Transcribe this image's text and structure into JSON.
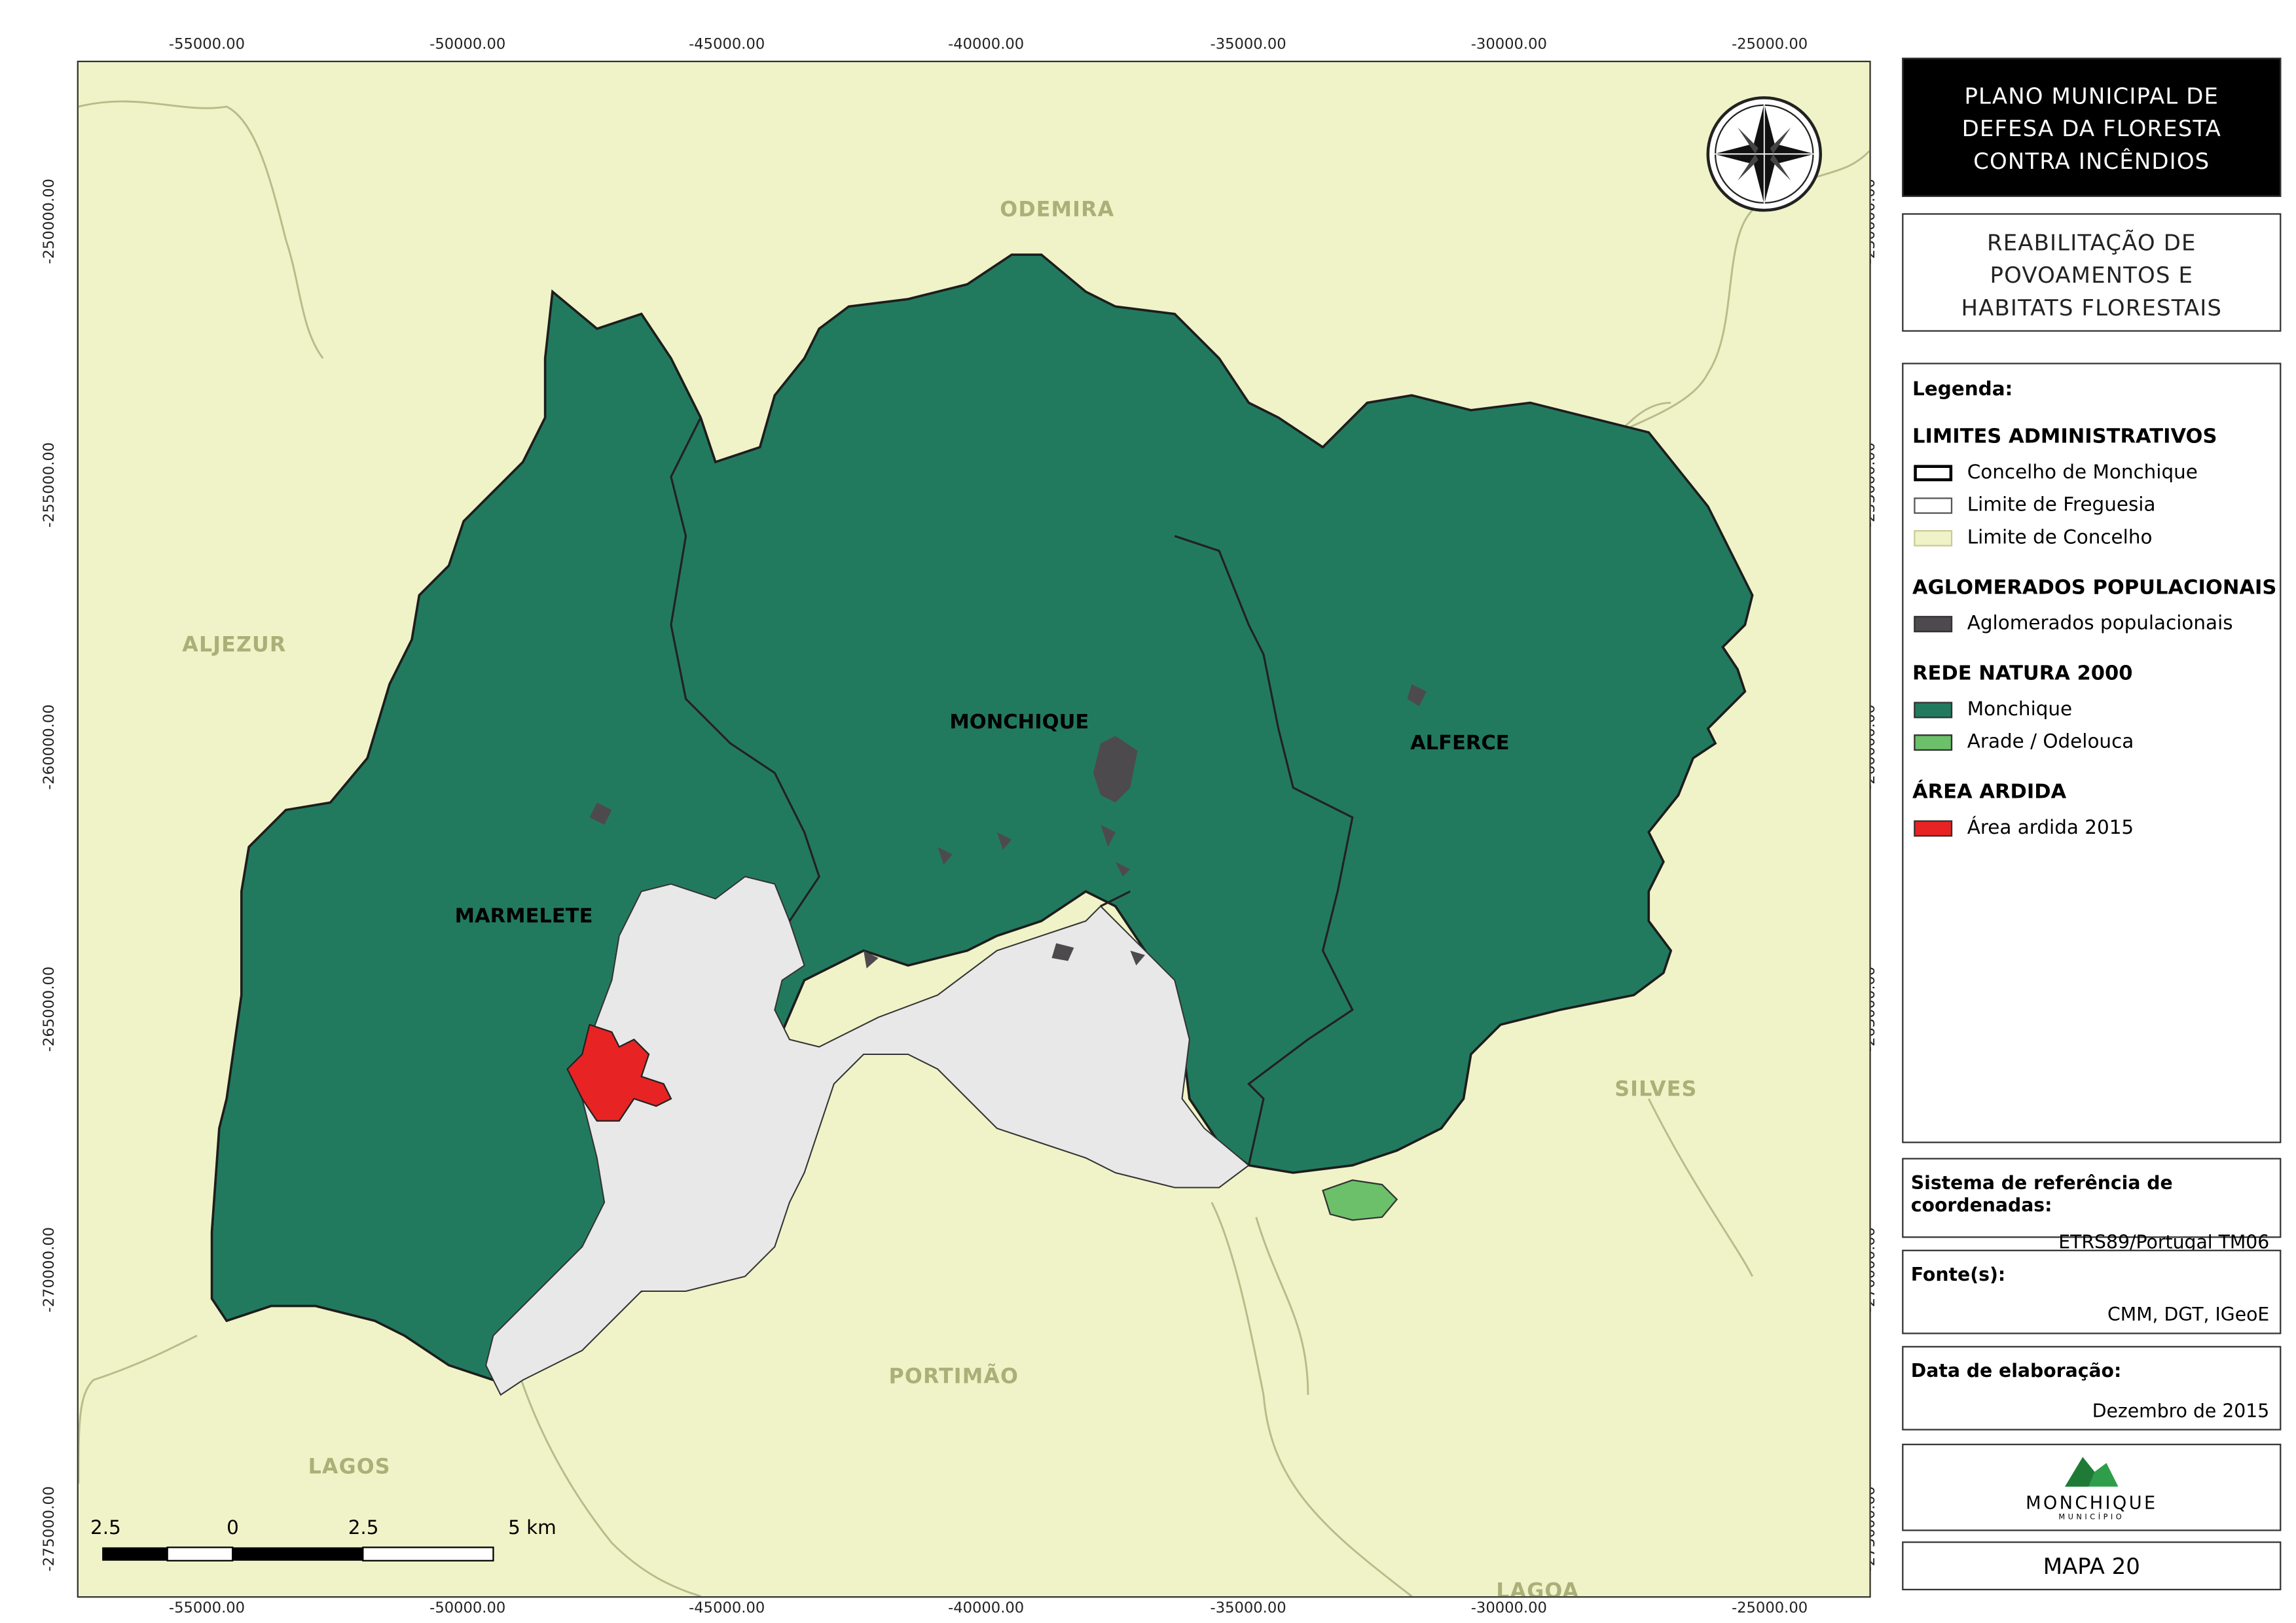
{
  "map": {
    "x_ticks": [
      "-55000.00",
      "-50000.00",
      "-45000.00",
      "-40000.00",
      "-35000.00",
      "-30000.00",
      "-25000.00"
    ],
    "y_ticks": [
      "-250000.00",
      "-255000.00",
      "-260000.00",
      "-265000.00",
      "-270000.00",
      "-275000.00"
    ],
    "neighbors": {
      "odemira": "ODEMIRA",
      "aljezur": "ALJEZUR",
      "silves": "SILVES",
      "portimao": "PORTIMÃO",
      "lagos": "LAGOS",
      "lagoa": "LAGOA"
    },
    "parishes": {
      "monchique": "MONCHIQUE",
      "alferce": "ALFERCE",
      "marmelete": "MARMELETE"
    },
    "scale_labels": [
      "2.5",
      "0",
      "2.5",
      "5 km"
    ],
    "icons": {
      "north_arrow": "compass-rose-icon"
    }
  },
  "title": {
    "plan": "PLANO MUNICIPAL DE DEFESA DA FLORESTA CONTRA INCÊNDIOS",
    "plan_lines": [
      "PLANO MUNICIPAL DE",
      "DEFESA DA FLORESTA",
      "CONTRA INCÊNDIOS"
    ],
    "subject_lines": [
      "REABILITAÇÃO DE",
      "POVOAMENTOS E",
      "HABITATS FLORESTAIS"
    ]
  },
  "legend": {
    "heading": "Legenda:",
    "sections": [
      {
        "title": "LIMITES ADMINISTRATIVOS",
        "items": [
          {
            "label": "Concelho de Monchique",
            "color": "#ffffff",
            "border": "#000000"
          },
          {
            "label": "Limite de Freguesia",
            "color": "#ffffff",
            "border": "#555555"
          },
          {
            "label": "Limite de Concelho",
            "color": "#f0f3c7",
            "border": "#c9cc9a"
          }
        ]
      },
      {
        "title": "AGLOMERADOS POPULACIONAIS",
        "items": [
          {
            "label": "Aglomerados populacionais",
            "color": "#4d4a4e",
            "border": "#333333"
          }
        ]
      },
      {
        "title": "REDE NATURA 2000",
        "items": [
          {
            "label": "Monchique",
            "color": "#227a5e",
            "border": "#333333"
          },
          {
            "label": "Arade / Odelouca",
            "color": "#6cc06a",
            "border": "#333333"
          }
        ]
      },
      {
        "title": "ÁREA ARDIDA",
        "items": [
          {
            "label": "Área ardida 2015",
            "color": "#e82323",
            "border": "#333333"
          }
        ]
      }
    ]
  },
  "info": {
    "crs_label": "Sistema de referência de coordenadas:",
    "crs_value": "ETRS89/Portugal TM06",
    "source_label": "Fonte(s):",
    "source_value": "CMM, DGT, IGeoE",
    "date_label": "Data de elaboração:",
    "date_value": "Dezembro de 2015",
    "logo_text": "MONCHIQUE",
    "logo_sub": "MUNICÍPIO",
    "map_number": "MAPA 20"
  },
  "colors": {
    "background": "#f0f3c7",
    "natura_monchique": "#227a5e",
    "natura_arade": "#6cc06a",
    "burned": "#e82323",
    "settlement": "#4d4a4e",
    "outside_natura": "#e8e8e8",
    "boundary": "#b8bc8a"
  }
}
